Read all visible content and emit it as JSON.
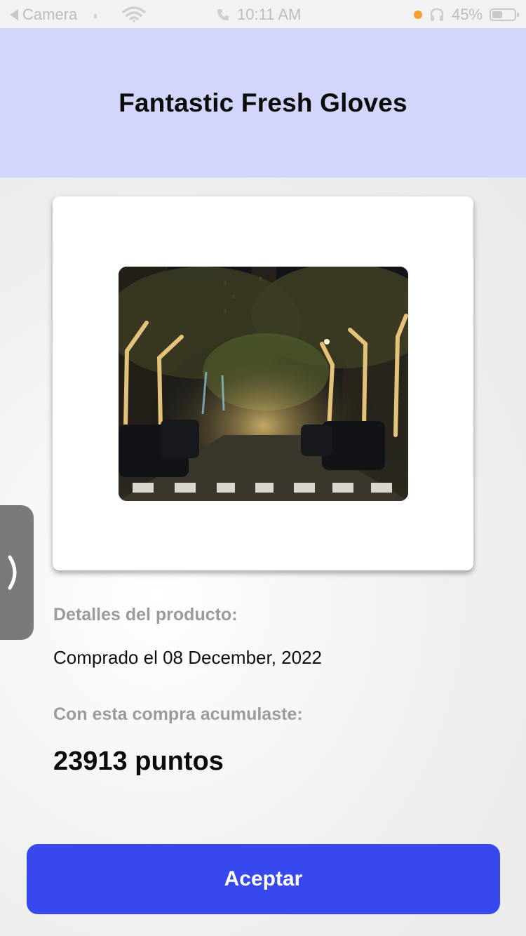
{
  "status_bar": {
    "back_label": "Camera",
    "time": "10:11 AM",
    "battery_percent": "45%",
    "battery_level": 0.45,
    "recording_dot_color": "#f0a030",
    "icons": [
      "back-arrow-icon",
      "wifi-icon",
      "phone-icon",
      "headphones-icon",
      "battery-icon"
    ]
  },
  "header": {
    "title": "Fantastic Fresh Gloves",
    "background_color": "#d2d6fa"
  },
  "product": {
    "image_alt": "Street lined with lit trees at night"
  },
  "details": {
    "section_label": "Detalles del producto:",
    "purchase_text": "Comprado el 08 December, 2022",
    "points_label": "Con esta compra acumulaste:",
    "points_text": "23913 puntos"
  },
  "side_handle": {
    "icon": "chevron-right-icon"
  },
  "footer": {
    "accept_label": "Aceptar",
    "accent_color": "#3749ec"
  }
}
